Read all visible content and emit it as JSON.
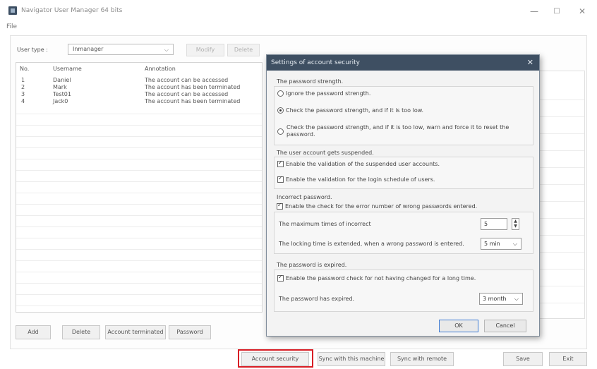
{
  "window": {
    "title": "Navigator User Manager 64 bits",
    "minimize": "—",
    "maximize": "□",
    "close": "✕"
  },
  "menu": {
    "file": "File"
  },
  "toolbar": {
    "user_type_label": "User type :",
    "user_type_value": "Inmanager",
    "modify": "Modify",
    "delete": "Delete"
  },
  "table": {
    "headers": [
      "No.",
      "Username",
      "Annotation"
    ],
    "rows": [
      [
        "1",
        "Daniel",
        "The account can be accessed"
      ],
      [
        "2",
        "Mark",
        "The account has been terminated"
      ],
      [
        "3",
        "Test01",
        "The account can be accessed"
      ],
      [
        "4",
        "Jack0",
        "The account has been terminated"
      ]
    ]
  },
  "list_buttons": {
    "add": "Add",
    "delete": "Delete",
    "account_terminated": "Account terminated",
    "password": "Password"
  },
  "bottom_bar": {
    "account_security": "Account security",
    "sync_machine": "Sync with this machine",
    "sync_remote": "Sync with remote",
    "save": "Save",
    "exit": "Exit"
  },
  "dialog": {
    "title": "Settings of account security",
    "close": "✕",
    "strength": {
      "heading": "The password strength.",
      "opt1": "Ignore the password strength.",
      "opt2": "Check the password strength, and if it is too low.",
      "opt3_line1": "Check the password strength, and if it is too low, warn and force it to reset the",
      "opt3_line2": "password.",
      "selected": 2
    },
    "suspended": {
      "heading": "The user account gets suspended.",
      "chk1": "Enable the validation of the suspended user accounts.",
      "chk2": "Enable the validation for the login schedule of users."
    },
    "incorrect": {
      "heading": "Incorrect password.",
      "chk": "Enable the check for the error number of wrong passwords entered.",
      "max_label": "The maximum times of incorrect",
      "max_value": "5",
      "lock_label": "The locking time is extended, when a wrong password is entered.",
      "lock_value": "5 min"
    },
    "expired": {
      "heading": "The password is expired.",
      "chk": "Enable the password check for not having changed for a long time.",
      "label": "The password has expired.",
      "value": "3 month"
    },
    "ok": "OK",
    "cancel": "Cancel"
  }
}
